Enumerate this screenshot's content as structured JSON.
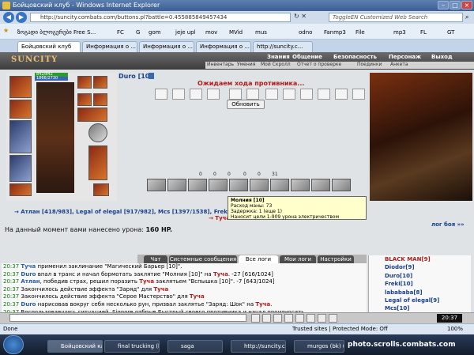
{
  "window": {
    "title": "Бойцовский клуб - Windows Internet Explorer"
  },
  "address": {
    "url": "http://suncity.combats.com/buttons.pl?battle=0.455885849457434"
  },
  "search": {
    "placeholder": "ToggleEN Customized Web Search"
  },
  "bookmarks": [
    "ზოგადი ბლოგერები Free S...",
    "FC",
    "G",
    "gom",
    "jeje upl",
    "mov",
    "MVid",
    "mus",
    "odno",
    "Fanmp3",
    "File",
    "mp3",
    "FL",
    "GT"
  ],
  "tabs": [
    "Бойцовский клуб",
    "Информация о ...",
    "Информация о ...",
    "Информация о ...",
    "http://suncity.c..."
  ],
  "game": {
    "logo": "SUNCITY",
    "menu_top": [
      "Знания",
      "Общение",
      "Безопасность",
      "Персонаж",
      "Выход"
    ],
    "menu_sub": [
      "Инвентарь",
      "Умения",
      "Мой Скролл",
      "Отчет о проверке",
      "Поединки",
      "Анкета"
    ],
    "hp": "842/842",
    "mana": "1866/2730",
    "player_name": "Duro [10]",
    "wait_message": "Ожидаем хода противника...",
    "refresh_label": "Обновить",
    "stats": [
      "0",
      "0",
      "0",
      "0",
      "0",
      "31"
    ],
    "tooltip": {
      "title": "Молния [10]",
      "lines": [
        "Расход маны: 73",
        "Задержка: 1 (еще 1)",
        "Наносит цели 1-909 урона электричеством"
      ]
    },
    "team_row": "→ Атлан [418/983], Legal of elegal [917/982], Mcs [1397/1538], Freki ... Signore [1681/1681]  против",
    "team_row_2": "→ Туча",
    "damage_prefix": "На данный момент вами нанесено урона:",
    "damage_value": "160 HP.",
    "battle_log_link": "лог боя »»",
    "chat_tabs": [
      "Чат",
      "Системные сообщения",
      "Все логи",
      "Мои логи",
      "Настройки"
    ],
    "chat_lines": [
      {
        "time": "20:37",
        "parts": [
          {
            "c": "n",
            "t": "Туча"
          },
          {
            "c": "",
            "t": " применил заклинание \"Магический Барьер [10]\"."
          }
        ]
      },
      {
        "time": "20:37",
        "parts": [
          {
            "c": "n",
            "t": "Duro"
          },
          {
            "c": "",
            "t": " впал в транс и начал бормотать заклятие \"Молния [10]\" на "
          },
          {
            "c": "r",
            "t": "Туча"
          },
          {
            "c": "",
            "t": ". -27 [616/1024]"
          }
        ]
      },
      {
        "time": "20:37",
        "parts": [
          {
            "c": "n",
            "t": "Атлан"
          },
          {
            "c": "",
            "t": ", победив страх, решил поразить "
          },
          {
            "c": "r",
            "t": "Туча"
          },
          {
            "c": "",
            "t": " заклятьем \"Вспышка [10]\". -7 [643/1024]"
          }
        ]
      },
      {
        "time": "20:37",
        "parts": [
          {
            "c": "",
            "t": "Закончилось действие эффекта \"Заряд\" для "
          },
          {
            "c": "r",
            "t": "Туча"
          }
        ]
      },
      {
        "time": "20:37",
        "parts": [
          {
            "c": "",
            "t": "Закончилось действие эффекта \"Серое Мастерство\" для "
          },
          {
            "c": "r",
            "t": "Туча"
          }
        ]
      },
      {
        "time": "20:37",
        "parts": [
          {
            "c": "n",
            "t": "Duro"
          },
          {
            "c": "",
            "t": " нарисовав вокруг себя несколько рун, призвал заклятье \"Заряд: Шок\" на "
          },
          {
            "c": "r",
            "t": "Туча"
          },
          {
            "c": "",
            "t": "."
          }
        ]
      },
      {
        "time": "20:37",
        "parts": [
          {
            "c": "",
            "t": "Воспользовавшись ситуацией, Signore отбрыв Быстрый своего противника и начал произносить..."
          }
        ]
      }
    ],
    "players": [
      {
        "name": "BLACK MAN[9]",
        "red": true
      },
      {
        "name": "Diodor[9]",
        "red": false
      },
      {
        "name": "Duro[10]",
        "red": false
      },
      {
        "name": "Freki[10]",
        "red": false
      },
      {
        "name": "labababa[8]",
        "red": false
      },
      {
        "name": "Legal of elegal[9]",
        "red": false
      },
      {
        "name": "Mcs[10]",
        "red": false
      }
    ],
    "clock": "20:37"
  },
  "statusbar": {
    "left": "Done",
    "trusted": "Trusted sites | Protected Mode: Off",
    "zoom": "100%"
  },
  "taskbar": {
    "items": [
      "Бойцовский клу...",
      "final trucking (b...",
      "saga",
      "http://suncity.co...",
      "murgos (bk) (...."
    ],
    "watermark": "photo.scrolls.combats.com"
  }
}
